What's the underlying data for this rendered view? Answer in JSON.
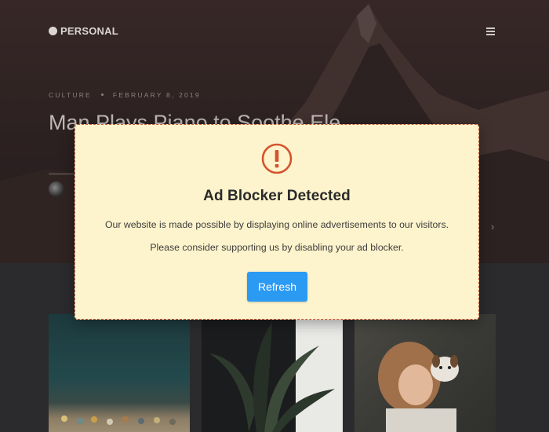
{
  "site": {
    "logo_text": "PERSONAL"
  },
  "article": {
    "category": "CULTURE",
    "date": "FEBRUARY 8, 2019",
    "title": "Man Plays Piano to Soothe Ele"
  },
  "modal": {
    "title": "Ad Blocker Detected",
    "body": "Our website is made possible by displaying online advertisements to our visitors. Please consider supporting us by disabling your ad blocker.",
    "button_label": "Refresh"
  },
  "colors": {
    "modal_background": "#fdf3cc",
    "modal_border": "#c85a3a",
    "warning_icon": "#d4532e",
    "button": "#2b9af3"
  },
  "icons": {
    "warning": "exclamation-circle-icon",
    "menu": "hamburger-menu-icon",
    "next": "chevron-right-icon"
  }
}
